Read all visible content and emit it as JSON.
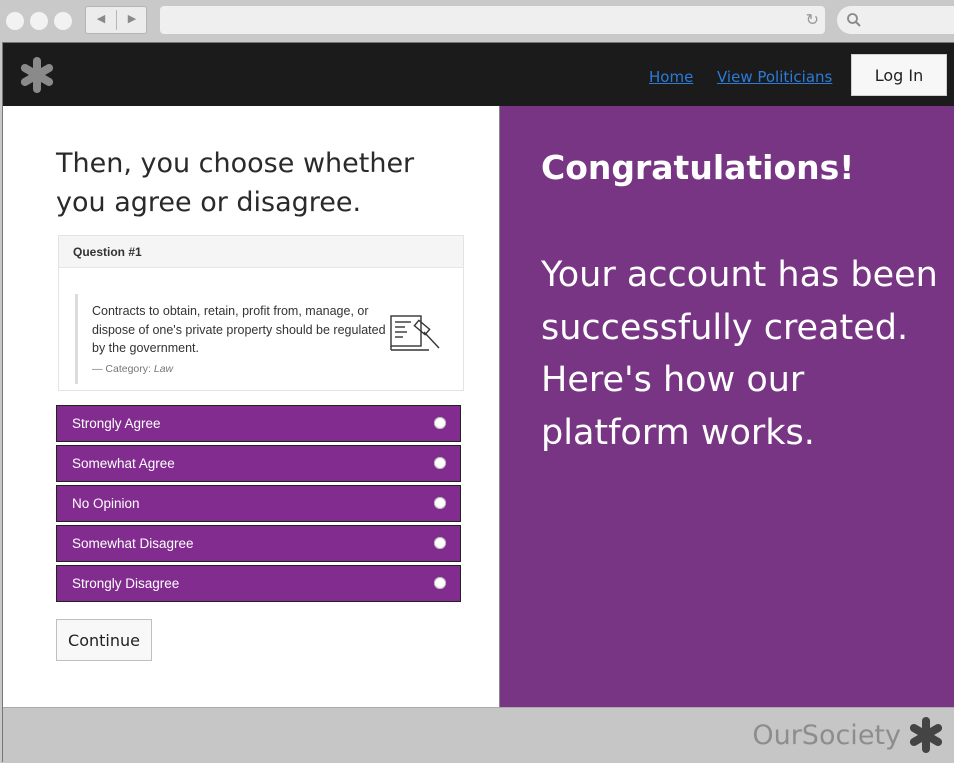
{
  "browser": {
    "back_glyph": "◀",
    "forward_glyph": "▶",
    "reload_glyph": "↻",
    "search_glyph": "⚲"
  },
  "nav": {
    "home": "Home",
    "view_politicians": "View Politicians",
    "login": "Log In"
  },
  "step": {
    "title": "Then, you choose whether you agree or disagree."
  },
  "question": {
    "number": "Question #1",
    "text": "Contracts to obtain, retain, profit from, manage, or dispose of one's private property should be regulated by the government.",
    "category_prefix": "—  Category:",
    "category": "Law",
    "icon": "law-gavel-icon"
  },
  "options": [
    "Strongly Agree",
    "Somewhat Agree",
    "No Opinion",
    "Somewhat Disagree",
    "Strongly Disagree"
  ],
  "continue_label": "Continue",
  "right": {
    "heading": "Congratulations!",
    "message": "Your account has been successfully created. Here's how our platform works."
  },
  "footer": {
    "brand": "OurSociety"
  },
  "colors": {
    "header_bg": "#1b1b1b",
    "accent_purple": "#783584",
    "option_purple": "#832c90",
    "link_blue": "#2b7bd9"
  }
}
